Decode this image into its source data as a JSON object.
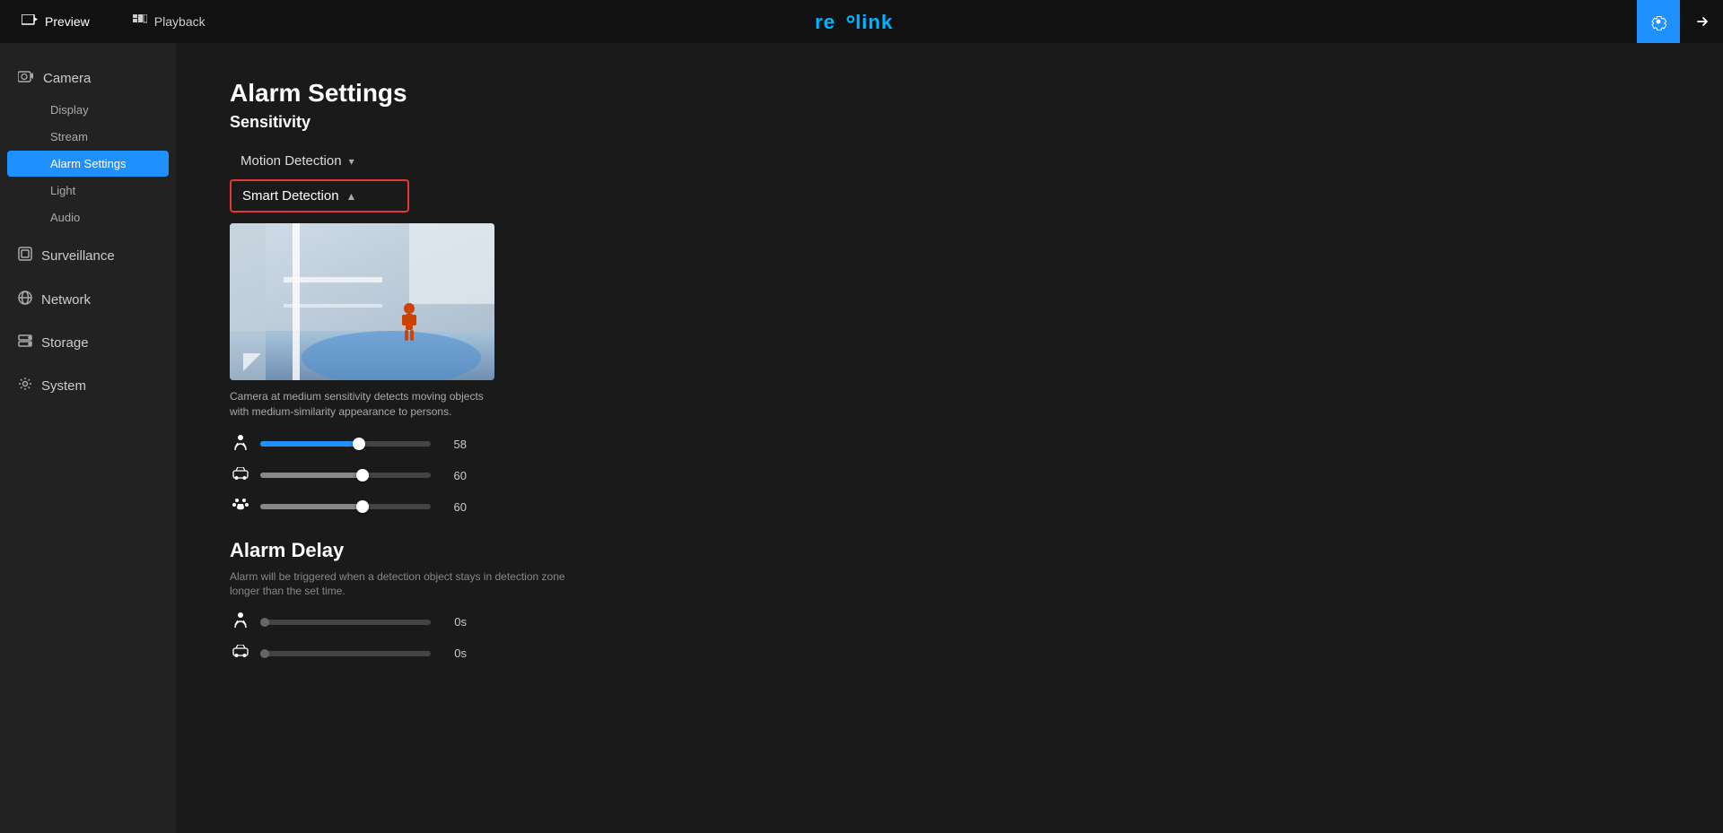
{
  "topbar": {
    "preview_label": "Preview",
    "playback_label": "Playback",
    "logo": "reolink",
    "settings_icon": "gear",
    "exit_icon": "arrow-right"
  },
  "sidebar": {
    "camera_label": "Camera",
    "camera_items": [
      {
        "id": "display",
        "label": "Display",
        "active": false
      },
      {
        "id": "stream",
        "label": "Stream",
        "active": false
      },
      {
        "id": "alarm-settings",
        "label": "Alarm Settings",
        "active": true
      },
      {
        "id": "light",
        "label": "Light",
        "active": false
      },
      {
        "id": "audio",
        "label": "Audio",
        "active": false
      }
    ],
    "surveillance_label": "Surveillance",
    "network_label": "Network",
    "storage_label": "Storage",
    "system_label": "System"
  },
  "content": {
    "page_title": "Alarm Settings",
    "sensitivity_title": "Sensitivity",
    "motion_detection_label": "Motion Detection",
    "smart_detection_label": "Smart Detection",
    "preview_caption": "Camera at medium sensitivity detects moving objects with medium-similarity appearance to persons.",
    "sliders": {
      "person_value": "58",
      "vehicle_value": "60",
      "pet_value": "60",
      "person_fill_pct": 58,
      "vehicle_fill_pct": 60,
      "pet_fill_pct": 60
    },
    "alarm_delay_title": "Alarm Delay",
    "alarm_delay_desc": "Alarm will be triggered when a detection object stays in detection zone longer than the set time.",
    "delay_sliders": {
      "person_value": "0s",
      "vehicle_value": "0s"
    }
  }
}
